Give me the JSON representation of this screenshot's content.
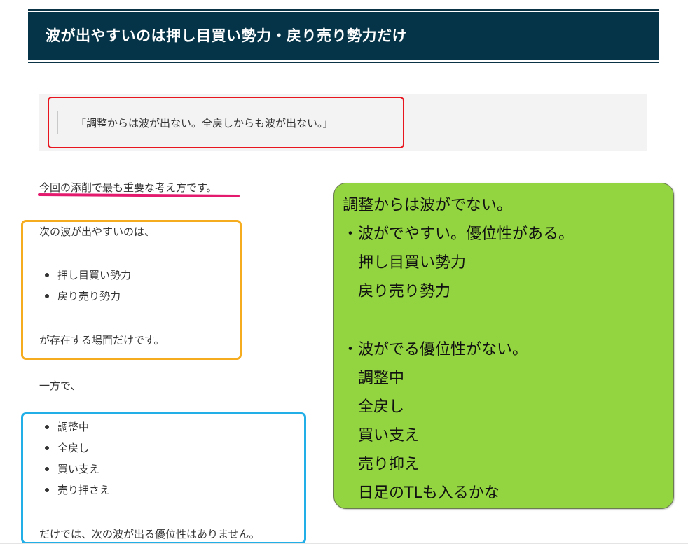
{
  "heading": {
    "title": "波が出やすいのは押し目買い勢力・戻り売り勢力だけ"
  },
  "quote": {
    "text": "「調整からは波が出ない。全戻しからも波が出ない。」"
  },
  "paragraphs": {
    "important": "今回の添削で最も重要な考え方です。",
    "next_wave": "次の波が出やすいのは、",
    "exists_only": "が存在する場面だけです。",
    "on_the_other_hand": "一方で、",
    "no_advantage": "だけでは、次の波が出る優位性はありません。"
  },
  "list_advantage": [
    "押し目買い勢力",
    "戻り売り勢力"
  ],
  "list_no_advantage": [
    "調整中",
    "全戻し",
    "買い支え",
    "売り押さえ"
  ],
  "note": {
    "lines": [
      "調整からは波がでない。",
      "・波がでやすい。優位性がある。",
      "　押し目買い勢力",
      "　戻り売り勢力",
      "",
      "・波がでる優位性がない。",
      "　調整中",
      "　全戻し",
      "　買い支え",
      "　売り抑え",
      "　日足のTLも入るかな"
    ]
  },
  "colors": {
    "heading_bg": "#053448",
    "red_frame": "#e8151f",
    "orange_frame": "#f5ad1f",
    "blue_frame": "#22aee6",
    "underline": "#e31a6e",
    "note_bg": "#93d541"
  }
}
